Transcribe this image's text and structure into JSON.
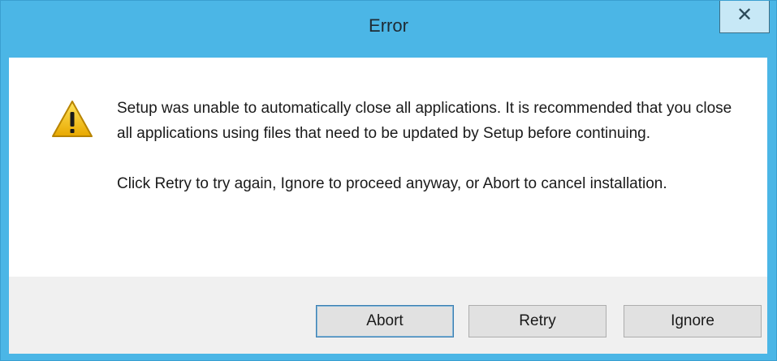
{
  "window": {
    "title": "Error",
    "close_glyph": "✕"
  },
  "icon": "warning-icon",
  "message": {
    "paragraph1": "Setup was unable to automatically close all applications. It is recommended that you close all applications using files that need to be updated by Setup before continuing.",
    "paragraph2": "Click Retry to try again, Ignore to proceed anyway, or Abort to cancel installation."
  },
  "buttons": {
    "abort": "Abort",
    "retry": "Retry",
    "ignore": "Ignore"
  },
  "colors": {
    "titlebar": "#4bb6e6",
    "footer": "#f0f0f0",
    "warning": "#f2c200"
  }
}
